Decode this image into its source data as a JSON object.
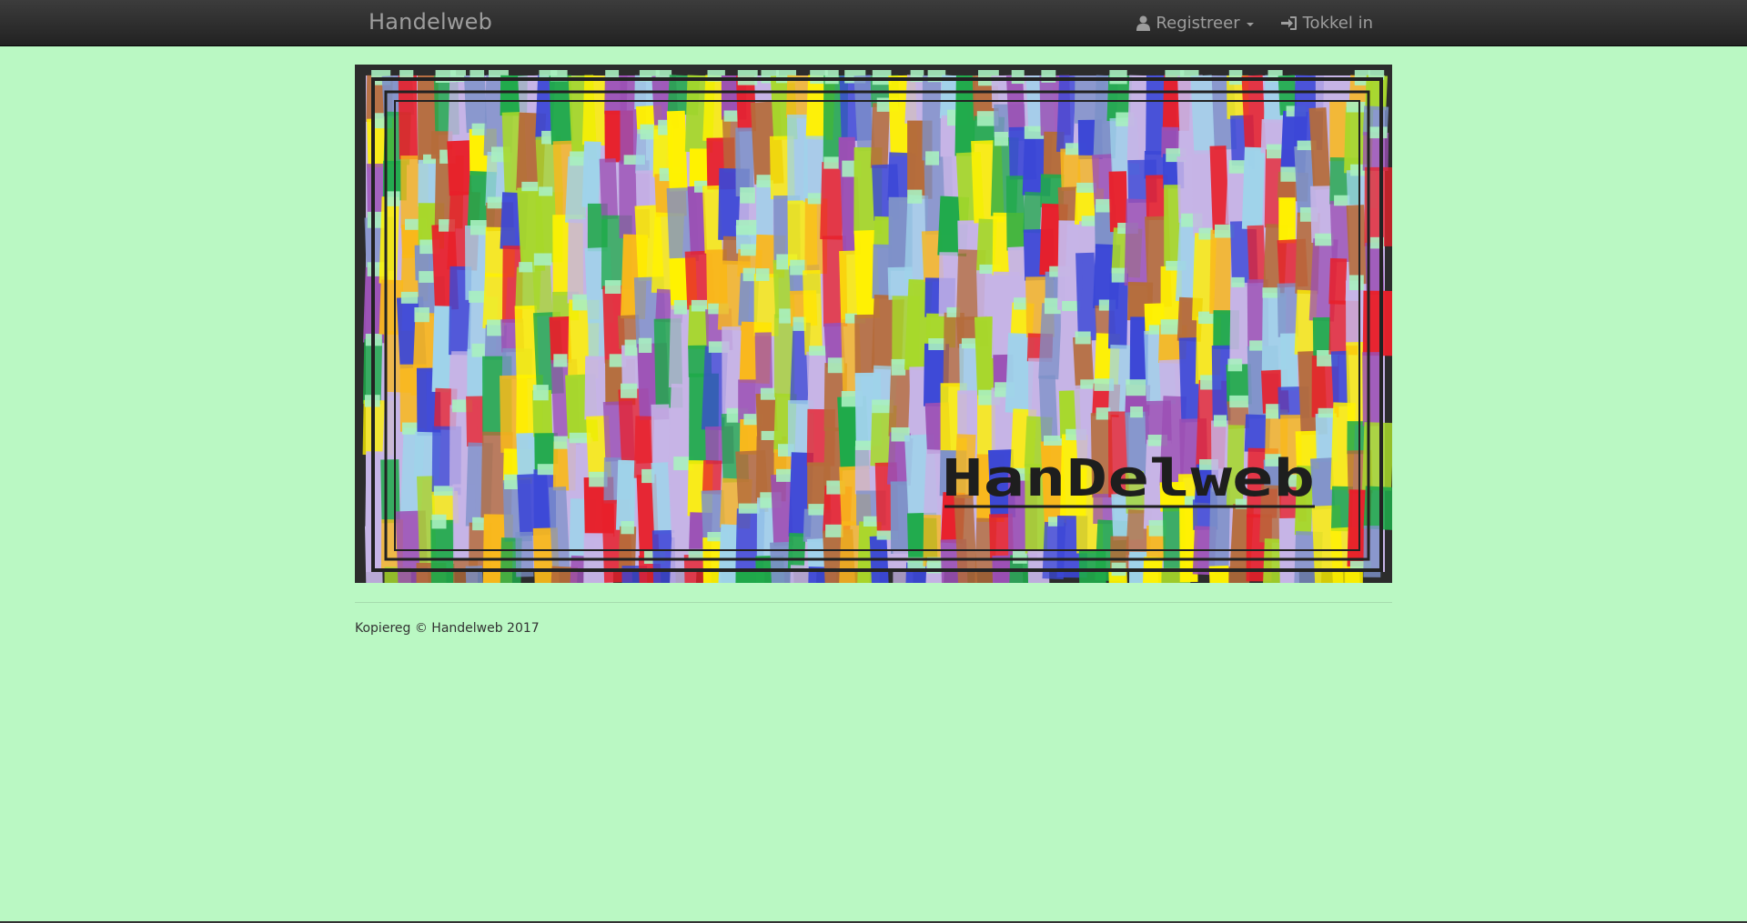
{
  "navbar": {
    "brand": "Handelweb",
    "register_label": "Registreer",
    "login_label": "Tokkel in",
    "register_icon": "user-icon",
    "login_icon": "sign-in-icon"
  },
  "banner": {
    "logo_text": "HanDelweb"
  },
  "footer": {
    "copyright": "Kopiereg © Handelweb 2017"
  },
  "colors": {
    "page_background": "#baf8c3",
    "navbar_background": "#222222",
    "navbar_text": "#9d9d9d",
    "palette": [
      "#e8202a",
      "#3b47d6",
      "#fff200",
      "#f9b81b",
      "#9b4fb4",
      "#c6b4e6",
      "#9fd3ea",
      "#1faa4a",
      "#a7d82a",
      "#7d91c8",
      "#b56c3a"
    ]
  }
}
